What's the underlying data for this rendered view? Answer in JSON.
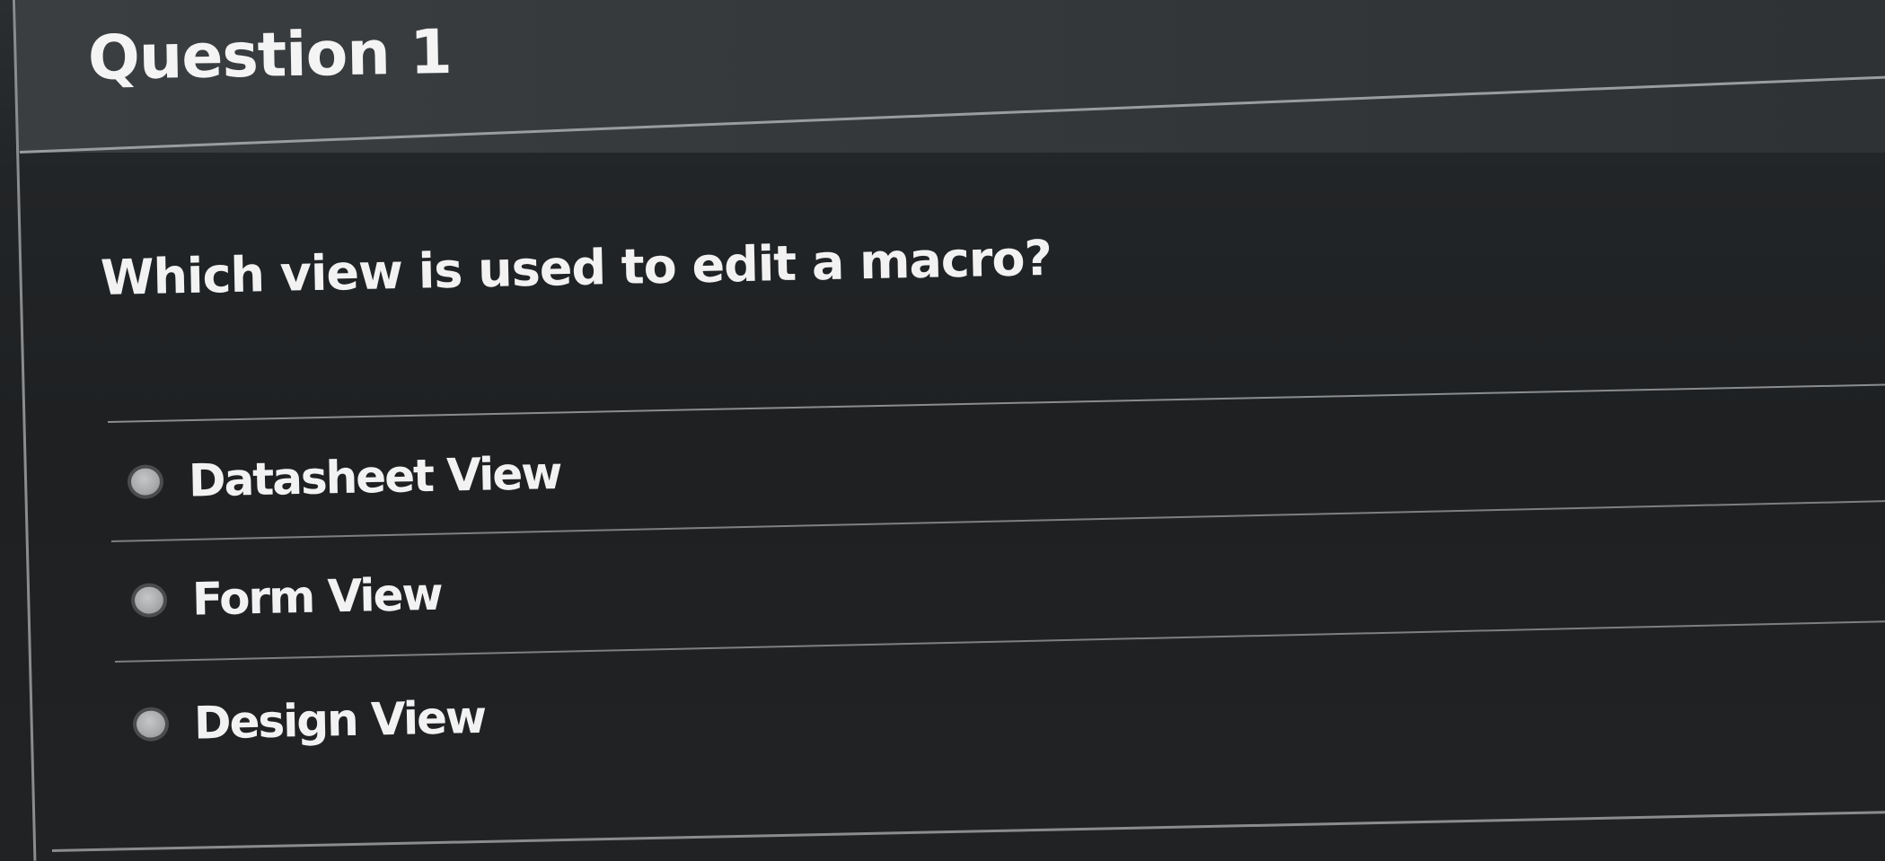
{
  "question": {
    "title": "Question 1",
    "text": "Which view is used to edit a macro?",
    "answers": [
      {
        "label": "Datasheet View",
        "selected": false
      },
      {
        "label": "Form View",
        "selected": false
      },
      {
        "label": "Design View",
        "selected": false
      }
    ]
  }
}
